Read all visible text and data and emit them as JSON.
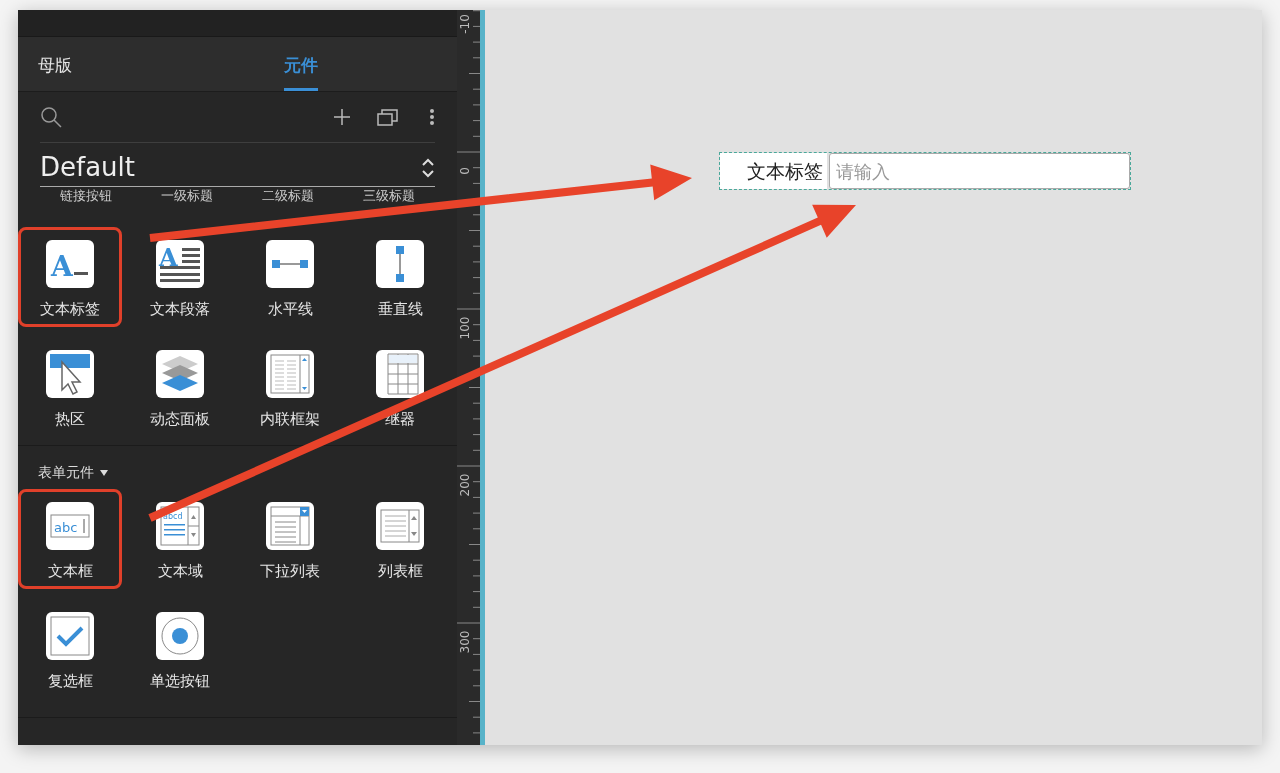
{
  "tabs": [
    {
      "label": "母版",
      "selected": false
    },
    {
      "label": "元件",
      "selected": true
    }
  ],
  "library": {
    "name": "Default"
  },
  "clipped_labels": [
    "链接按钮",
    "一级标题",
    "二级标题",
    "三级标题"
  ],
  "sections": [
    {
      "items": [
        {
          "label": "文本标签",
          "kind": "label",
          "icon_text": "A",
          "highlighted": true
        },
        {
          "label": "文本段落",
          "kind": "paragraph",
          "icon_text": "A",
          "highlighted": false
        },
        {
          "label": "水平线",
          "kind": "hline",
          "highlighted": false
        },
        {
          "label": "垂直线",
          "kind": "vline",
          "highlighted": false
        },
        {
          "label": "热区",
          "kind": "hotspot",
          "highlighted": false
        },
        {
          "label": "动态面板",
          "kind": "panel",
          "highlighted": false
        },
        {
          "label": "内联框架",
          "kind": "iframe",
          "highlighted": false
        },
        {
          "label": "继器",
          "kind": "repeater",
          "highlighted": false
        }
      ]
    },
    {
      "title": "表单元件",
      "items": [
        {
          "label": "文本框",
          "kind": "textbox",
          "icon_text": "abc",
          "highlighted": true
        },
        {
          "label": "文本域",
          "kind": "textarea",
          "icon_text": "abcd",
          "highlighted": false
        },
        {
          "label": "下拉列表",
          "kind": "dropdown",
          "highlighted": false
        },
        {
          "label": "列表框",
          "kind": "listbox",
          "highlighted": false
        },
        {
          "label": "复选框",
          "kind": "checkbox",
          "highlighted": false
        },
        {
          "label": "单选按钮",
          "kind": "radio",
          "highlighted": false
        }
      ]
    }
  ],
  "ruler": [
    "-10",
    "0",
    "100",
    "200",
    "300"
  ],
  "canvas": {
    "label": "文本标签",
    "input_placeholder": "请输入"
  }
}
